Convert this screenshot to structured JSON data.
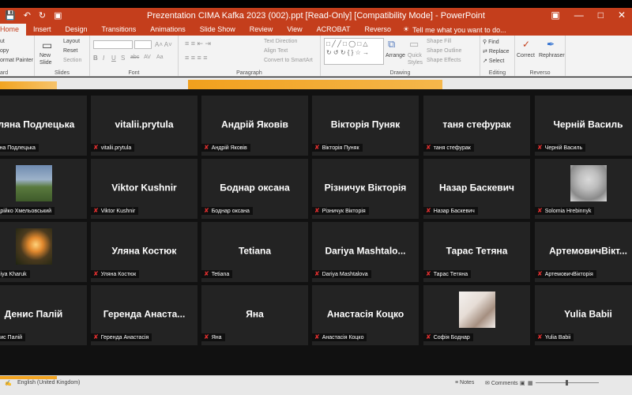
{
  "titlebar": {
    "title": "Prezentation CIMA Kafka 2023 (002).ppt [Read-Only] [Compatibility Mode] - PowerPoint",
    "qat_icons": [
      "save-icon",
      "undo-icon",
      "redo-icon",
      "present-icon"
    ],
    "window_buttons": [
      "minimize-icon",
      "restore-icon",
      "close-icon"
    ]
  },
  "ribbon_tabs": [
    "Home",
    "Insert",
    "Design",
    "Transitions",
    "Animations",
    "Slide Show",
    "Review",
    "View",
    "ACROBAT",
    "Reverso"
  ],
  "tell_me": "Tell me what you want to do...",
  "ribbon": {
    "clipboard": {
      "label": "ard",
      "cut": "ut",
      "copy": "opy",
      "format_painter": "ormat Painter"
    },
    "slides": {
      "label": "Slides",
      "new_slide": "New",
      "new_slide2": "Slide",
      "layout": "Layout",
      "reset": "Reset",
      "section": "Section"
    },
    "font": {
      "label": "Font",
      "bold": "B",
      "italic": "I",
      "underline": "U",
      "shadow": "S",
      "strike": "abc",
      "spacing": "AV",
      "case": "Aa"
    },
    "paragraph": {
      "label": "Paragraph",
      "text_direction": "Text Direction",
      "align_text": "Align Text",
      "convert_smartart": "Convert to SmartArt"
    },
    "drawing": {
      "label": "Drawing",
      "arrange": "Arrange",
      "quick_styles": "Quick",
      "quick_styles2": "Styles",
      "shape_fill": "Shape Fill",
      "shape_outline": "Shape Outline",
      "shape_effects": "Shape Effects"
    },
    "editing": {
      "label": "Editing",
      "find": "Find",
      "replace": "Replace",
      "select": "Select"
    },
    "reverso": {
      "label": "Reverso",
      "correct": "Correct",
      "rephraser": "Rephraser"
    }
  },
  "participants": [
    {
      "name": "Уляна Подлецька",
      "label": "Уляна Подлецька",
      "avatar": null
    },
    {
      "name": "vitalii.prytula",
      "label": "vitalii.prytula",
      "avatar": null
    },
    {
      "name": "Андрій Яковів",
      "label": "Андрій Яковів",
      "avatar": null
    },
    {
      "name": "Вікторія Пуняк",
      "label": "Вікторія Пуняк",
      "avatar": null
    },
    {
      "name": "таня стефурак",
      "label": "таня стефурак",
      "avatar": null
    },
    {
      "name": "Черній Василь",
      "label": "Черній Василь",
      "avatar": null
    },
    {
      "name": "",
      "label": "Андрійко Хмельовський",
      "avatar": "av-field"
    },
    {
      "name": "Viktor Kushnir",
      "label": "Viktor Kushnir",
      "avatar": null
    },
    {
      "name": "Боднар оксана",
      "label": "Боднар оксана",
      "avatar": null
    },
    {
      "name": "Різничук Вікторія",
      "label": "Різничук Вікторія",
      "avatar": null
    },
    {
      "name": "Назар Баскевич",
      "label": "Назар Баскевич",
      "avatar": null
    },
    {
      "name": "",
      "label": "Solomia Hrebinnyk",
      "avatar": "av-girl"
    },
    {
      "name": "",
      "label": "Nadiya Kharuk",
      "avatar": "av-sunset"
    },
    {
      "name": "Уляна Костюк",
      "label": "Уляна Костюк",
      "avatar": null
    },
    {
      "name": "Tetiana",
      "label": "Tetiana",
      "avatar": null
    },
    {
      "name": "Dariya  Mashtalo...",
      "label": "Dariya Mashtalova",
      "avatar": null
    },
    {
      "name": "Тарас Тетяна",
      "label": "Тарас Тетяна",
      "avatar": null
    },
    {
      "name": "АртемовичВікт...",
      "label": "АртемовичВікторія",
      "avatar": null
    },
    {
      "name": "Денис Палій",
      "label": "Денис Палій",
      "avatar": null
    },
    {
      "name": "Геренда  Анаста...",
      "label": "Геренда Анастасія",
      "avatar": null
    },
    {
      "name": "Яна",
      "label": "Яна",
      "avatar": null
    },
    {
      "name": "Анастасія Коцко",
      "label": "Анастасія Коцко",
      "avatar": null
    },
    {
      "name": "",
      "label": "Софія Боднар",
      "avatar": "av-woman"
    },
    {
      "name": "Yulia Babii",
      "label": "Yulia Babii",
      "avatar": null
    }
  ],
  "statusbar": {
    "language": "English (United Kingdom)",
    "notes": "Notes",
    "comments": "Comments"
  },
  "colors": {
    "accent": "#c43e1c",
    "tile_bg": "#232323",
    "mic_off": "#e02f2f",
    "slide_strip_orange": "#f2a421"
  }
}
